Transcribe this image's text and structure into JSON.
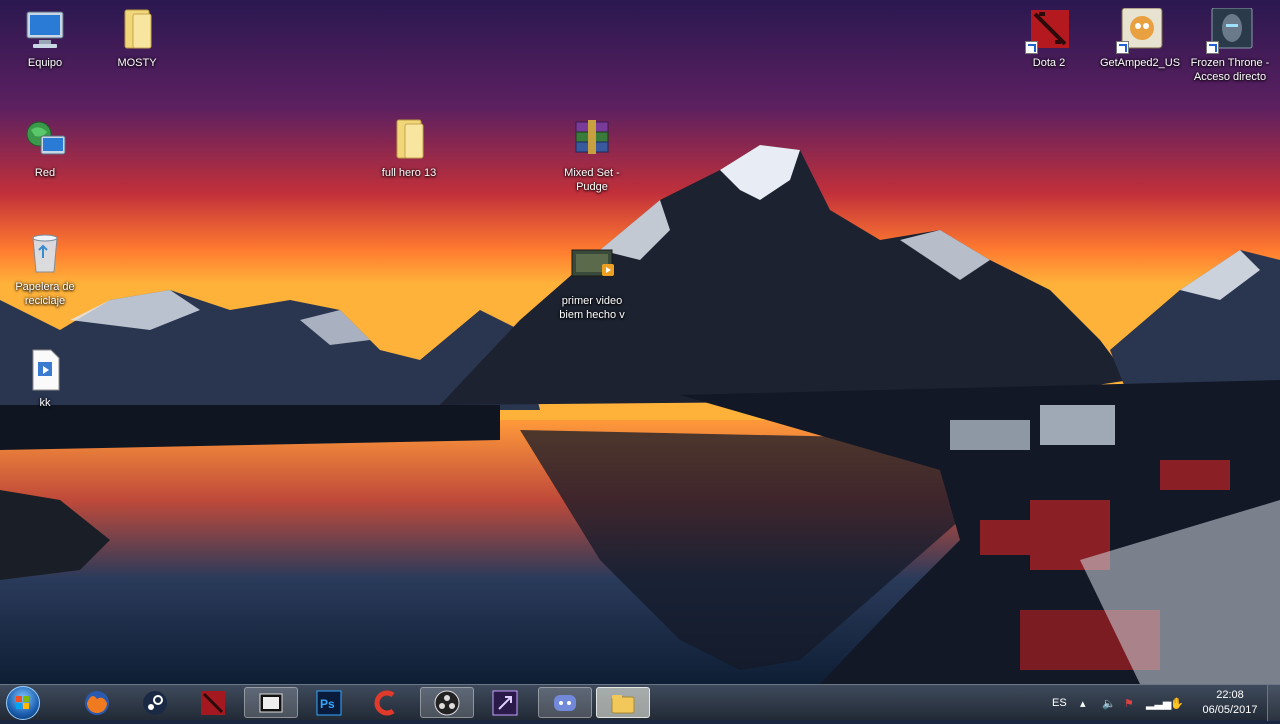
{
  "desktop": {
    "icons": [
      {
        "label": "Equipo"
      },
      {
        "label": "MOSTY"
      },
      {
        "label": "Red"
      },
      {
        "label": "full hero 13"
      },
      {
        "label": "Mixed Set - Pudge"
      },
      {
        "label": "Papelera de reciclaje"
      },
      {
        "label": "primer video biem hecho v"
      },
      {
        "label": "kk"
      },
      {
        "label": "Dota 2"
      },
      {
        "label": "GetAmped2_US"
      },
      {
        "label": "Frozen Throne - Acceso directo"
      }
    ]
  },
  "taskbar": {
    "apps": [
      "firefox-icon",
      "steam-icon",
      "dota2-icon",
      "video-editor-icon",
      "photoshop-icon",
      "ccleaner-icon",
      "obs-icon",
      "premiere-icon",
      "discord-icon",
      "file-explorer-icon"
    ],
    "tray": {
      "language": "ES",
      "time": "22:08",
      "date": "06/05/2017"
    }
  },
  "colors": {
    "sky_top": "#3a1a5c",
    "sunset": "#ff6a2a",
    "water": "#1c3a5a",
    "taskbar": "#2a3342"
  }
}
